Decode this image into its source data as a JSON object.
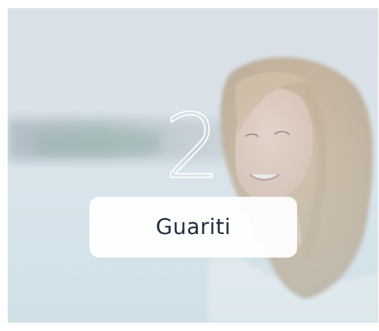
{
  "card": {
    "number": "2",
    "label": "Guariti"
  },
  "colors": {
    "label_text": "#1e2a3b",
    "number_outline": "#ffffff",
    "label_background": "#ffffff"
  }
}
